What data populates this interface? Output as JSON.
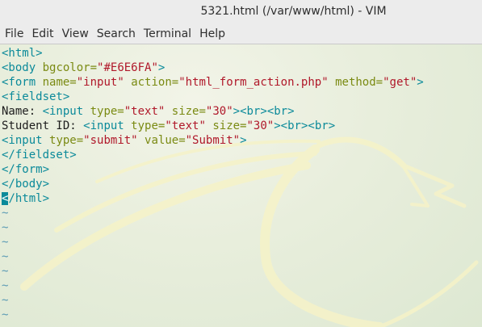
{
  "window": {
    "title": "5321.html (/var/www/html) - VIM"
  },
  "menu": [
    "File",
    "Edit",
    "View",
    "Search",
    "Terminal",
    "Help"
  ],
  "code": [
    "<html>",
    "<body bgcolor=\"#E6E6FA\">",
    "<form name=\"input\" action=\"html_form_action.php\" method=\"get\">",
    "<fieldset>",
    "Name: <input type=\"text\" size=\"30\"><br><br>",
    "Student ID: <input type=\"text\" size=\"30\"><br><br>",
    "<input type=\"submit\" value=\"Submit\">",
    "</fieldset>",
    "</form>",
    "</body>",
    "</html>"
  ],
  "empty_line_marker": "~",
  "empty_line_count": 8,
  "colors": {
    "tag": "#0b8a9a",
    "attribute": "#7a8a12",
    "string": "#b0182a",
    "text": "#1d1d1d",
    "tilde": "#5a9ab4",
    "cursor_bg": "#0b8a9a"
  },
  "cursor": {
    "line": 11,
    "column": 1
  }
}
